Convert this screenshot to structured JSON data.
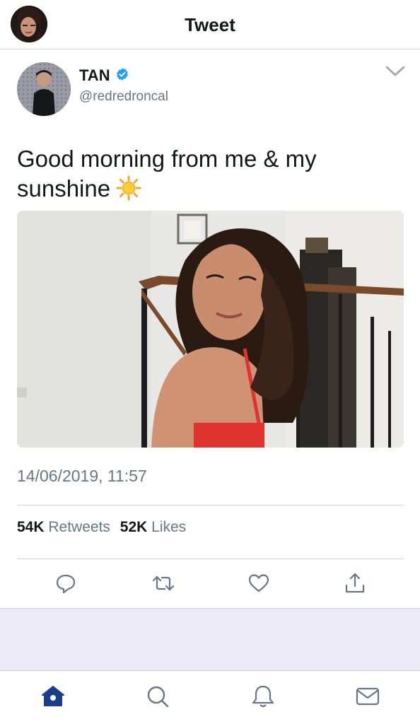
{
  "header": {
    "title": "Tweet",
    "avatar_icon": "profile-avatar"
  },
  "tweet": {
    "author_name": "TAN",
    "handle": "@redredroncal",
    "verified": true,
    "text": "Good morning from me & my sunshine",
    "emoji_icon": "sun-emoji",
    "timestamp": "14/06/2019, 11:57",
    "stats": {
      "retweets_count": "54K",
      "retweets_label": "Retweets",
      "likes_count": "52K",
      "likes_label": "Likes"
    },
    "actions": [
      "reply-icon",
      "retweet-icon",
      "like-icon",
      "share-icon"
    ]
  },
  "tabbar": {
    "tabs": [
      "home-icon",
      "search-icon",
      "notifications-icon",
      "messages-icon"
    ],
    "active_tab": "home"
  },
  "colors": {
    "primary_text": "#14171a",
    "secondary_text": "#657786",
    "accent_blue": "#1da1f2",
    "home_active": "#1a3e8c"
  }
}
